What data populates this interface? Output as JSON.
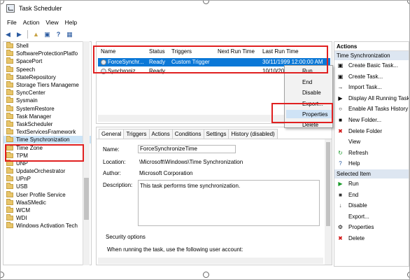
{
  "window": {
    "title": "Task Scheduler"
  },
  "menu": [
    "File",
    "Action",
    "View",
    "Help"
  ],
  "toolbar": [
    "back-icon",
    "forward-icon",
    "folder-up-icon",
    "show-hide-tree-icon",
    "help-icon",
    "console-icon"
  ],
  "tree": {
    "items": [
      "Shell",
      "SoftwareProtectionPlatfo",
      "SpacePort",
      "Speech",
      "StateRepository",
      "Storage Tiers Manageme",
      "SyncCenter",
      "Sysmain",
      "SystemRestore",
      "Task Manager",
      "TaskScheduler",
      "TextServicesFramework",
      "Time Synchronization",
      "Time Zone",
      "TPM",
      "UNP",
      "UpdateOrchestrator",
      "UPnP",
      "USB",
      "User Profile Service",
      "WaaSMedic",
      "WCM",
      "WDI",
      "Windows Activation Tech"
    ],
    "selected": "Time Synchronization"
  },
  "tasklist": {
    "columns": [
      "Name",
      "Status",
      "Triggers",
      "Next Run Time",
      "Last Run Time"
    ],
    "rows": [
      {
        "name": "ForceSynchr...",
        "status": "Ready",
        "triggers": "Custom Trigger",
        "next": "",
        "last": "30/11/1999 12:00:00 AM"
      },
      {
        "name": "Synchroniz...",
        "status": "Ready",
        "triggers": "",
        "next": "",
        "last": "10/10/20"
      }
    ]
  },
  "context_menu": {
    "items": [
      "Run",
      "End",
      "Disable",
      "Export...",
      "Properties",
      "Delete"
    ],
    "highlighted": "Properties"
  },
  "detail": {
    "tabs": [
      "General",
      "Triggers",
      "Actions",
      "Conditions",
      "Settings",
      "History (disabled)"
    ],
    "name_label": "Name:",
    "name_value": "ForceSynchronizeTime",
    "location_label": "Location:",
    "location_value": "\\Microsoft\\Windows\\Time Synchronization",
    "author_label": "Author:",
    "author_value": "Microsoft Corporation",
    "description_label": "Description:",
    "description_value": "This task performs time synchronization.",
    "security_label": "Security options",
    "security_text": "When running the task, use the following user account:"
  },
  "actions": {
    "header": "Actions",
    "section1": "Time Synchronization",
    "items1": [
      {
        "label": "Create Basic Task...",
        "icon": "basic-task-icon"
      },
      {
        "label": "Create Task...",
        "icon": "create-task-icon"
      },
      {
        "label": "Import Task...",
        "icon": "import-icon"
      },
      {
        "label": "Display All Running Tasks",
        "icon": "running-tasks-icon"
      },
      {
        "label": "Enable All Tasks History",
        "icon": "history-icon"
      },
      {
        "label": "New Folder...",
        "icon": "new-folder-icon"
      },
      {
        "label": "Delete Folder",
        "icon": "delete-icon"
      },
      {
        "label": "View",
        "icon": "view-icon"
      },
      {
        "label": "Refresh",
        "icon": "refresh-icon"
      },
      {
        "label": "Help",
        "icon": "help-icon"
      }
    ],
    "section2": "Selected Item",
    "items2": [
      {
        "label": "Run",
        "icon": "run-icon"
      },
      {
        "label": "End",
        "icon": "end-icon"
      },
      {
        "label": "Disable",
        "icon": "disable-icon"
      },
      {
        "label": "Export...",
        "icon": "export-icon"
      },
      {
        "label": "Properties",
        "icon": "properties-icon"
      },
      {
        "label": "Delete",
        "icon": "delete-icon"
      }
    ]
  },
  "colors": {
    "selection": "#0b78d7",
    "annotation": "#e02020",
    "folder": "#e8c56a"
  }
}
